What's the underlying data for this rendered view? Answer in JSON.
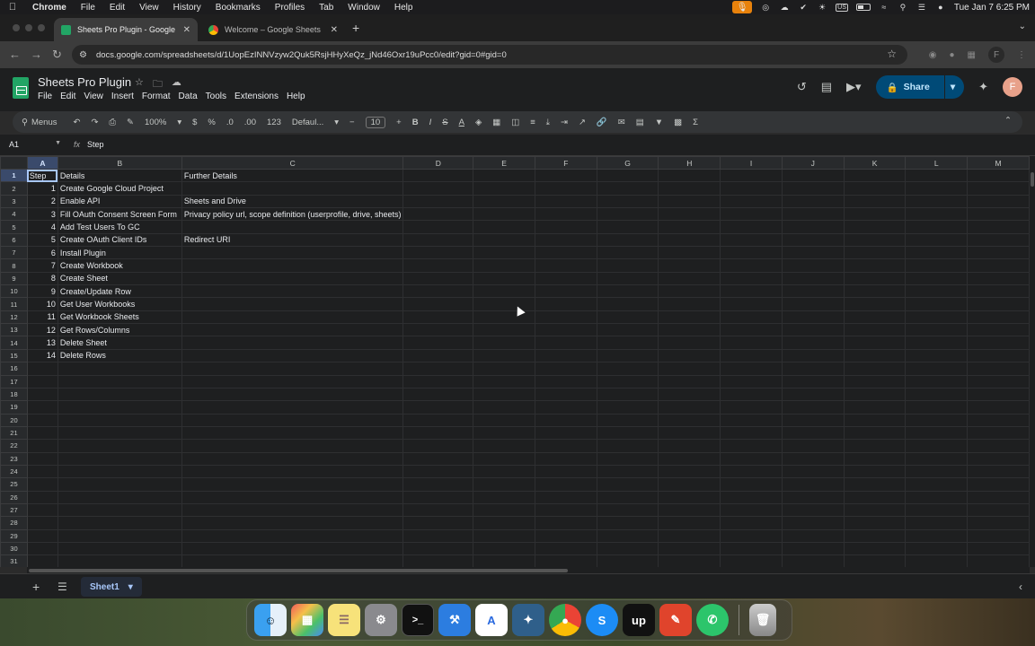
{
  "macos_menubar": {
    "app_name": "Chrome",
    "items": [
      "File",
      "Edit",
      "View",
      "History",
      "Bookmarks",
      "Profiles",
      "Tab",
      "Window",
      "Help"
    ],
    "input_source": "US",
    "datetime": "Tue Jan 7  6:25 PM"
  },
  "browser": {
    "tabs": [
      {
        "title": "Sheets Pro Plugin - Google Sh",
        "active": true
      },
      {
        "title": "Welcome – Google Sheets Pr",
        "active": false
      }
    ],
    "url": "docs.google.com/spreadsheets/d/1UopEzINNVzyw2Quk5RsjHHyXeQz_jNd46Oxr19uPcc0/edit?gid=0#gid=0",
    "profile_initial": "F"
  },
  "sheets": {
    "doc_title": "Sheets Pro Plugin",
    "menu": [
      "File",
      "Edit",
      "View",
      "Insert",
      "Format",
      "Data",
      "Tools",
      "Extensions",
      "Help"
    ],
    "share_label": "Share",
    "avatar_initial": "F",
    "toolbar": {
      "menus_label": "Menus",
      "zoom": "100%",
      "currency": "$",
      "percent": "%",
      "dec_decrease": ".0",
      "dec_increase": ".00",
      "number_format": "123",
      "font": "Defaul...",
      "font_size": "10",
      "bold": "B",
      "italic": "I",
      "strike": "S",
      "text_color": "A"
    },
    "name_box": "A1",
    "formula_value": "Step",
    "columns": [
      "A",
      "B",
      "C",
      "D",
      "E",
      "F",
      "G",
      "H",
      "I",
      "J",
      "K",
      "L",
      "M"
    ],
    "rows": [
      [
        "Step",
        "Details",
        "Further Details"
      ],
      [
        "1",
        "Create Google Cloud Project",
        ""
      ],
      [
        "2",
        "Enable API",
        "Sheets and Drive"
      ],
      [
        "3",
        "Fill OAuth Consent Screen Form",
        "Privacy policy url, scope definition (userprofile, drive, sheets)"
      ],
      [
        "4",
        "Add Test Users To GC",
        ""
      ],
      [
        "5",
        "Create OAuth Client IDs",
        "Redirect URI"
      ],
      [
        "6",
        "Install Plugin",
        ""
      ],
      [
        "7",
        "Create Workbook",
        ""
      ],
      [
        "8",
        "Create Sheet",
        ""
      ],
      [
        "9",
        "Create/Update Row",
        ""
      ],
      [
        "10",
        "Get User Workbooks",
        ""
      ],
      [
        "11",
        "Get Workbook Sheets",
        ""
      ],
      [
        "12",
        "Get Rows/Columns",
        ""
      ],
      [
        "13",
        "Delete Sheet",
        ""
      ],
      [
        "14",
        "Delete Rows",
        ""
      ]
    ],
    "total_visible_rows": 31,
    "sheet_tab": "Sheet1"
  },
  "dock": {
    "apps": [
      "finder-app",
      "launchpad-app",
      "notes-app",
      "system-settings-app",
      "terminal-app",
      "xcode-app",
      "android-studio-app",
      "mysql-workbench-app",
      "chrome-app",
      "shazam-app",
      "upwork-app",
      "pencil-app",
      "whatsapp-app",
      "trash"
    ]
  },
  "colors": {
    "sheets_green": "#22a565",
    "share_bg": "#004a77",
    "selection_blue": "#a8c7fa",
    "mic_orange": "#e8820c"
  }
}
